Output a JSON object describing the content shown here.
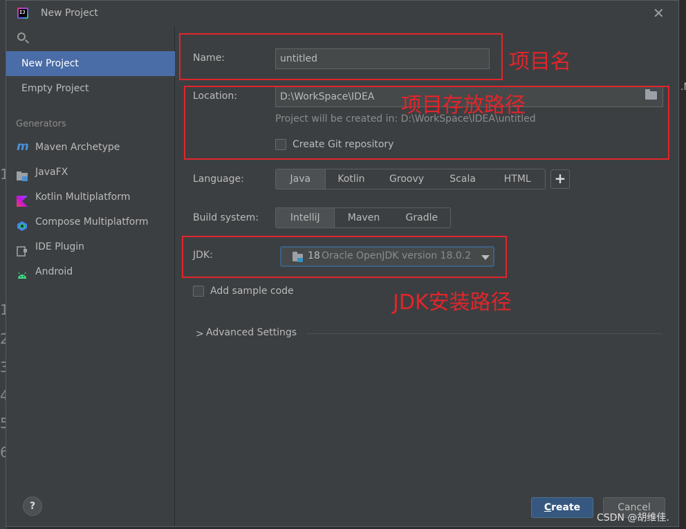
{
  "window": {
    "title": "New Project"
  },
  "sidebar": {
    "items": [
      {
        "label": "New Project",
        "selected": true
      },
      {
        "label": "Empty Project",
        "selected": false
      }
    ],
    "generators_header": "Generators",
    "generators": [
      {
        "label": "Maven Archetype",
        "icon": "maven-icon"
      },
      {
        "label": "JavaFX",
        "icon": "javafx-folder-icon"
      },
      {
        "label": "Kotlin Multiplatform",
        "icon": "kotlin-icon"
      },
      {
        "label": "Compose Multiplatform",
        "icon": "compose-icon"
      },
      {
        "label": "IDE Plugin",
        "icon": "plugin-icon"
      },
      {
        "label": "Android",
        "icon": "android-icon"
      }
    ],
    "help_label": "?"
  },
  "form": {
    "name_label": "Name:",
    "name_value": "untitled",
    "location_label": "Location:",
    "location_value": "D:\\WorkSpace\\IDEA",
    "location_hint": "Project will be created in: D:\\WorkSpace\\IDEA\\untitled",
    "git_label": "Create Git repository",
    "git_checked": false,
    "language_label": "Language:",
    "languages": [
      "Java",
      "Kotlin",
      "Groovy",
      "Scala",
      "HTML"
    ],
    "language_selected": "Java",
    "add_language": "+",
    "build_label": "Build system:",
    "build_systems": [
      "IntelliJ",
      "Maven",
      "Gradle"
    ],
    "build_selected": "IntelliJ",
    "jdk_label": "JDK:",
    "jdk_version": "18",
    "jdk_desc": "Oracle OpenJDK version 18.0.2",
    "sample_label": "Add sample code",
    "sample_checked": false,
    "advanced_label": "Advanced Settings",
    "advanced_chevron": ">"
  },
  "buttons": {
    "create": "Create",
    "create_mnemonic": "C",
    "create_rest": "reate",
    "cancel": "Cancel"
  },
  "annotations": {
    "name": "项目名",
    "location": "项目存放路径",
    "jdk": "JDK安装路径"
  },
  "background": {
    "gutter_numbers": [
      "1",
      "1",
      "2",
      "3",
      "4",
      "5",
      "6"
    ],
    "right_edge_text": ".N"
  },
  "watermark": "CSDN @胡维佳."
}
